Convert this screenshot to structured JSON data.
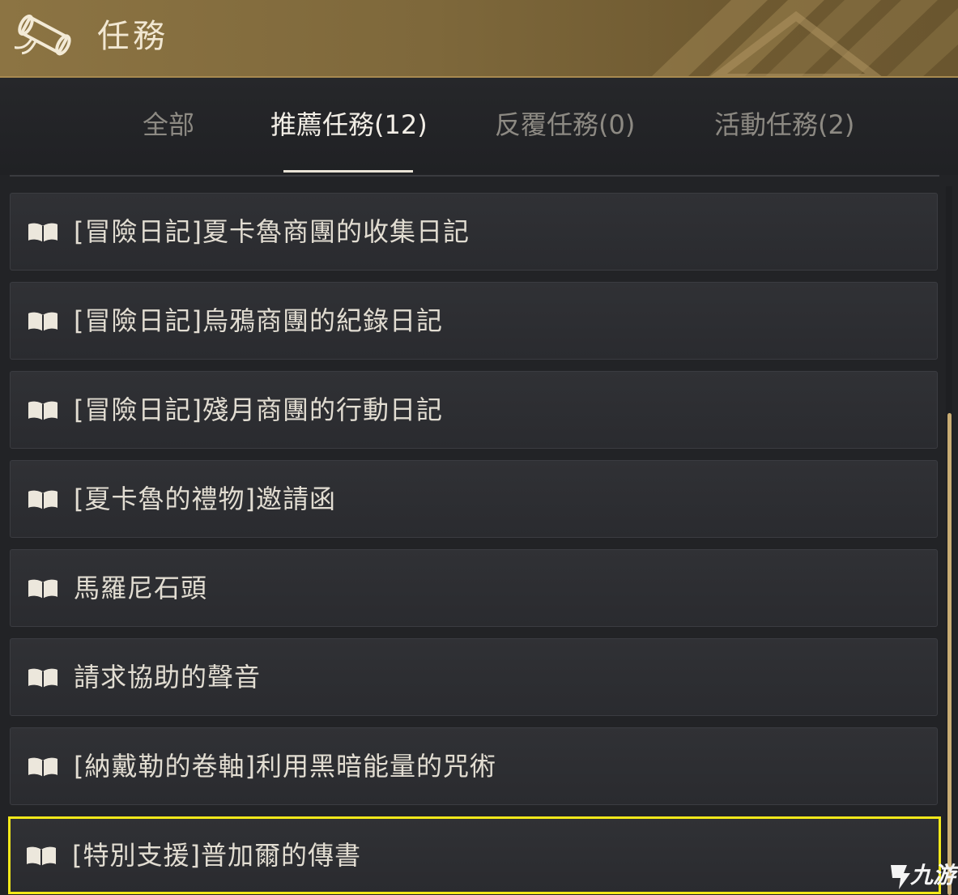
{
  "header": {
    "title": "任務",
    "icon": "scroll-icon"
  },
  "tabs": [
    {
      "label": "全部",
      "active": false
    },
    {
      "label": "推薦任務(12)",
      "active": true
    },
    {
      "label": "反覆任務(0)",
      "active": false
    },
    {
      "label": "活動任務(2)",
      "active": false
    }
  ],
  "quests": [
    {
      "label": "[冒險日記]夏卡魯商團的收集日記",
      "icon": "book-icon",
      "selected": false
    },
    {
      "label": "[冒險日記]烏鴉商團的紀錄日記",
      "icon": "book-icon",
      "selected": false
    },
    {
      "label": "[冒險日記]殘月商團的行動日記",
      "icon": "book-icon",
      "selected": false
    },
    {
      "label": "[夏卡魯的禮物]邀請函",
      "icon": "book-icon",
      "selected": false
    },
    {
      "label": "馬羅尼石頭",
      "icon": "book-icon",
      "selected": false
    },
    {
      "label": "請求協助的聲音",
      "icon": "book-icon",
      "selected": false
    },
    {
      "label": "[納戴勒的卷軸]利用黑暗能量的咒術",
      "icon": "book-icon",
      "selected": false
    },
    {
      "label": "[特別支援]普加爾的傳書",
      "icon": "book-icon",
      "selected": true
    }
  ],
  "watermark": {
    "text": "九游"
  },
  "colors": {
    "header_gold": "#8c7443",
    "selection_highlight": "#f2e81a",
    "active_tab_text": "#f2eee6",
    "inactive_tab_text": "#8d8a83",
    "scrollbar_thumb": "#c9ad74"
  }
}
